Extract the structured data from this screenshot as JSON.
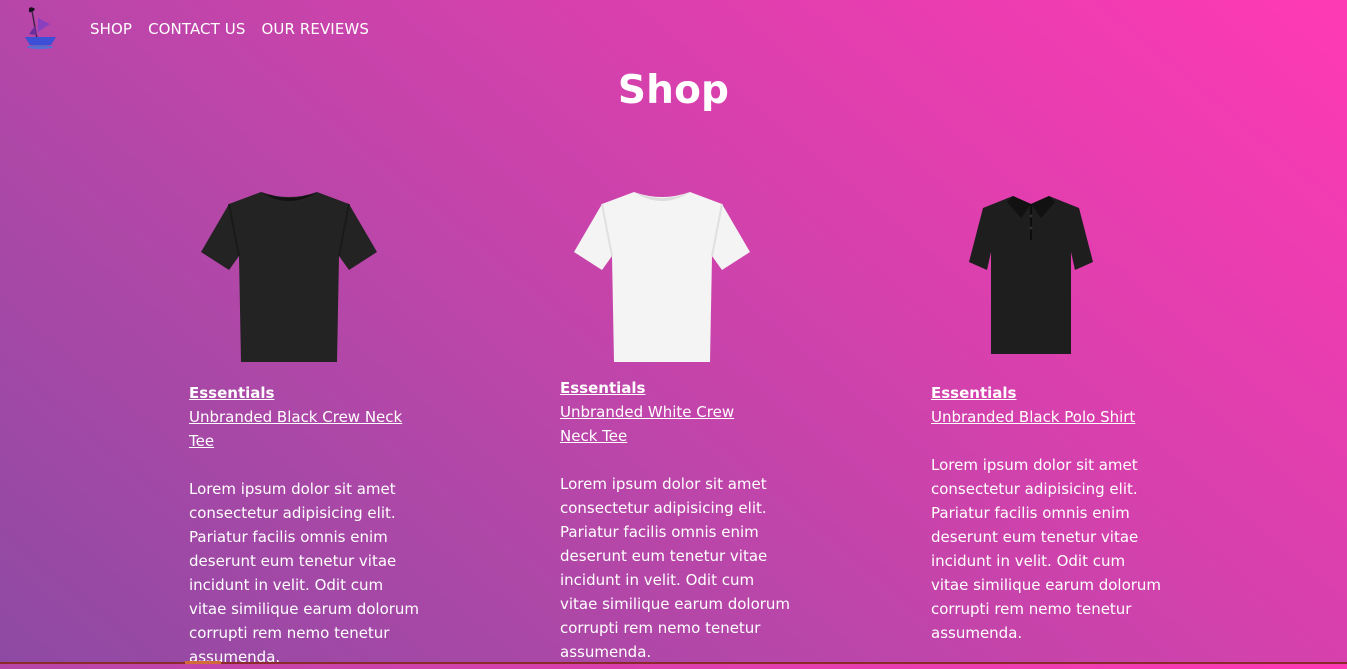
{
  "nav": {
    "logo_icon": "pirate-ship-logo-icon",
    "links": [
      "SHOP",
      "CONTACT US",
      "OUR REVIEWS"
    ]
  },
  "page": {
    "title": "Shop"
  },
  "products": [
    {
      "category": "Essentials",
      "name": "Unbranded Black Crew Neck Tee",
      "description": "Lorem ipsum dolor sit amet consectetur adipisicing elit. Pariatur facilis omnis enim deserunt eum tenetur vitae incidunt in velit. Odit cum vitae similique earum dolorum corrupti rem nemo tenetur assumenda.",
      "image_icon": "black-crew-neck-tshirt-icon",
      "color": "#232323"
    },
    {
      "category": "Essentials",
      "name": "Unbranded White Crew Neck Tee",
      "description": "Lorem ipsum dolor sit amet consectetur adipisicing elit. Pariatur facilis omnis enim deserunt eum tenetur vitae incidunt in velit. Odit cum vitae similique earum dolorum corrupti rem nemo tenetur assumenda.",
      "image_icon": "white-crew-neck-tshirt-icon",
      "color": "#f4f4f4"
    },
    {
      "category": "Essentials",
      "name": "Unbranded Black Polo Shirt",
      "description": "Lorem ipsum dolor sit amet consectetur adipisicing elit. Pariatur facilis omnis enim deserunt eum tenetur vitae incidunt in velit. Odit cum vitae similique earum dolorum corrupti rem nemo tenetur assumenda.",
      "image_icon": "black-polo-shirt-icon",
      "color": "#1e1e1e"
    }
  ]
}
